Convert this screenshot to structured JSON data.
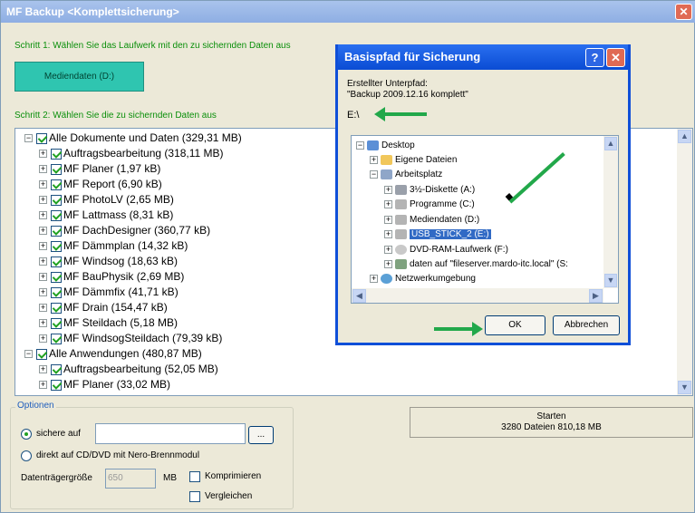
{
  "window": {
    "title": "MF Backup <Komplettsicherung>",
    "close_symbol": "✕"
  },
  "step1": {
    "label": "Schritt 1: Wählen Sie das Laufwerk mit den zu sichernden Daten aus",
    "drive_button": "Mediendaten (D:)"
  },
  "step2": {
    "label": "Schritt 2: Wählen Sie die zu sichernden Daten aus"
  },
  "tree": [
    {
      "text": "Alle Dokumente und Daten (329,31 MB)",
      "level": 0,
      "exp": "−"
    },
    {
      "text": "Auftragsbearbeitung (318,11 MB)",
      "level": 1,
      "exp": "+"
    },
    {
      "text": "MF Planer (1,97 kB)",
      "level": 1,
      "exp": "+"
    },
    {
      "text": "MF Report (6,90 kB)",
      "level": 1,
      "exp": "+"
    },
    {
      "text": "MF PhotoLV (2,65 MB)",
      "level": 1,
      "exp": "+"
    },
    {
      "text": "MF Lattmass (8,31 kB)",
      "level": 1,
      "exp": "+"
    },
    {
      "text": "MF DachDesigner (360,77 kB)",
      "level": 1,
      "exp": "+"
    },
    {
      "text": "MF Dämmplan (14,32 kB)",
      "level": 1,
      "exp": "+"
    },
    {
      "text": "MF Windsog (18,63 kB)",
      "level": 1,
      "exp": "+"
    },
    {
      "text": "MF BauPhysik (2,69 MB)",
      "level": 1,
      "exp": "+"
    },
    {
      "text": "MF Dämmfix (41,71 kB)",
      "level": 1,
      "exp": "+"
    },
    {
      "text": "MF Drain (154,47 kB)",
      "level": 1,
      "exp": "+"
    },
    {
      "text": "MF Steildach (5,18 MB)",
      "level": 1,
      "exp": "+"
    },
    {
      "text": "MF WindsogSteildach (79,39 kB)",
      "level": 1,
      "exp": "+"
    },
    {
      "text": "Alle Anwendungen (480,87 MB)",
      "level": 0,
      "exp": "−"
    },
    {
      "text": "Auftragsbearbeitung (52,05 MB)",
      "level": 1,
      "exp": "+"
    },
    {
      "text": "MF Planer (33,02 MB)",
      "level": 1,
      "exp": "+"
    }
  ],
  "options": {
    "legend": "Optionen",
    "radio1": "sichere auf",
    "browse": "...",
    "radio2": "direkt auf CD/DVD mit Nero-Brennmodul",
    "size_label": "Datenträgergröße",
    "size_value": "650",
    "size_unit": "MB",
    "compress": "Komprimieren",
    "compare": "Vergleichen"
  },
  "start": {
    "line1": "Starten",
    "line2": "3280 Dateien 810,18 MB"
  },
  "dialog": {
    "title": "Basispfad für Sicherung",
    "help": "?",
    "close": "✕",
    "subpath_label": "Erstellter Unterpfad:",
    "subpath_value": "\"Backup 2009.12.16 komplett\"",
    "path": "E:\\",
    "ok": "OK",
    "cancel": "Abbrechen",
    "folders": [
      {
        "text": "Desktop",
        "exp": "−"
      },
      {
        "text": "Eigene Dateien",
        "exp": "+"
      },
      {
        "text": "Arbeitsplatz",
        "exp": "−"
      },
      {
        "text": "3½-Diskette (A:)",
        "exp": "+"
      },
      {
        "text": "Programme (C:)",
        "exp": "+"
      },
      {
        "text": "Mediendaten (D:)",
        "exp": "+"
      },
      {
        "text": "USB_STICK_2 (E:)",
        "exp": "+"
      },
      {
        "text": "DVD-RAM-Laufwerk (F:)",
        "exp": "+"
      },
      {
        "text": "daten auf \"fileserver.mardo-itc.local\" (S:",
        "exp": "+"
      },
      {
        "text": "Netzwerkumgebung",
        "exp": "+"
      }
    ]
  }
}
